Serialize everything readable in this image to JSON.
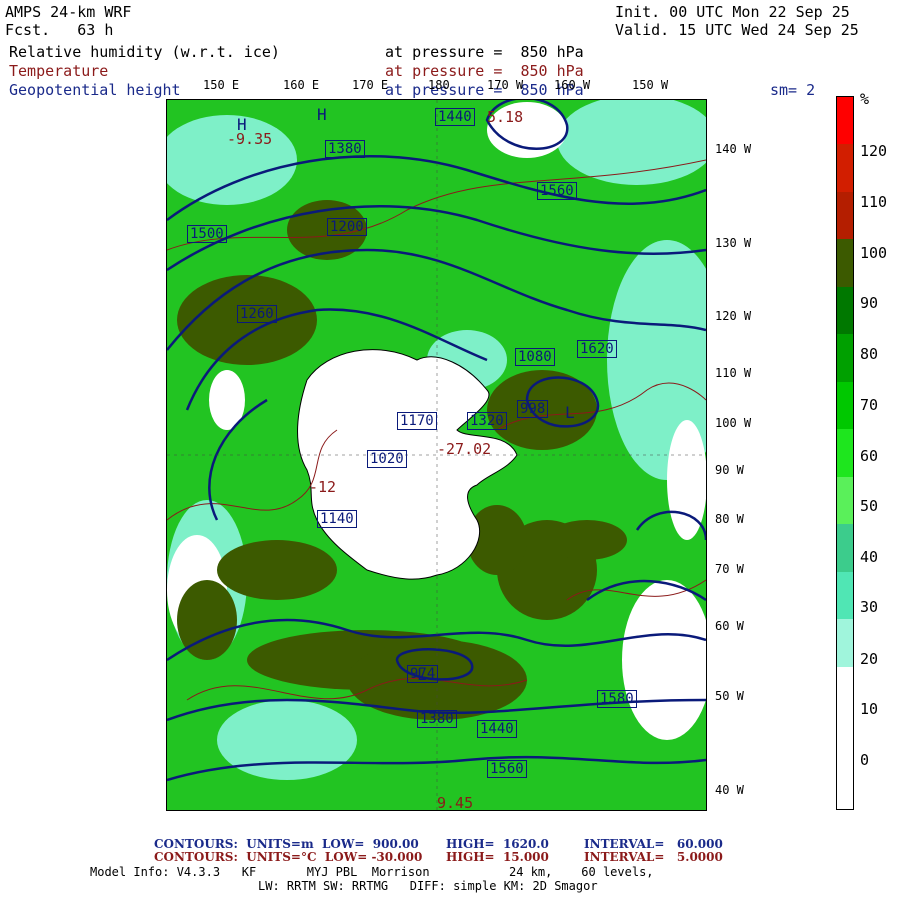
{
  "header": {
    "model_title": "AMPS 24-km WRF",
    "forecast": "Fcst.   63 h",
    "init_time": "Init. 00 UTC Mon 22 Sep 25",
    "valid_time": "Valid. 15 UTC Wed 24 Sep 25",
    "field1_name": "Relative humidity (w.r.t. ice)",
    "field1_level": "at pressure =  850 hPa",
    "field2_name": "Temperature",
    "field2_level": "at pressure =  850 hPa",
    "field3_name": "Geopotential height",
    "field3_level": "at pressure =  850 hPa",
    "smoothing": "sm= 2",
    "colors": {
      "rh_label": "#000000",
      "temp_label": "#8b1a1a",
      "height_label": "#1a2a8a"
    }
  },
  "map": {
    "lon_labels": [
      "150 E",
      "160 E",
      "170 E",
      "180",
      "170 W",
      "160 W",
      "150 W"
    ],
    "lat_labels": [
      "140 W",
      "130 W",
      "120 W",
      "110 W",
      "100 W",
      "90 W",
      "80 W",
      "70 W",
      "60 W",
      "50 W",
      "40 W"
    ],
    "height_contour_labels": [
      "1440",
      "1380",
      "1500",
      "1200",
      "1560",
      "1620",
      "1320",
      "1020",
      "1260",
      "1170",
      "1080",
      "1140",
      "998",
      "974",
      "1380",
      "1440",
      "1560",
      "1580"
    ],
    "temp_labels": [
      "-27.02",
      "-9.35",
      "5.18",
      "-12",
      "9.45"
    ],
    "high_label": "H",
    "low_label": "L",
    "colors": {
      "land": "#ffffff",
      "height_contour": "#0a1a7a",
      "temp_contour": "#8b1a1a",
      "rh_high": "#3a5a1a",
      "rh_mid": "#1ecb1e",
      "rh_low": "#5ee8b8"
    }
  },
  "colorbar": {
    "unit": "%",
    "labels": [
      "120",
      "110",
      "100",
      "90",
      "80",
      "70",
      "60",
      "50",
      "40",
      "30",
      "20",
      "10",
      "0"
    ],
    "segments": [
      "#ff0000",
      "#d21e00",
      "#b41e00",
      "#3c5a00",
      "#007800",
      "#00a000",
      "#00c800",
      "#1ee61e",
      "#5af05a",
      "#3ccc8c",
      "#50e6b4",
      "#a0f5dc",
      "#ffffff",
      "#ffffff",
      "#ffffff"
    ]
  },
  "footer": {
    "contours1_prefix": "CONTOURS:  UNITS=m  LOW=  900.00",
    "contours1_high": "HIGH=  1620.0",
    "contours1_interval": "INTERVAL=   60.000",
    "contours2_prefix": "CONTOURS:  UNITS=°C  LOW= -30.000",
    "contours2_high": "HIGH=  15.000",
    "contours2_interval": "INTERVAL=   5.0000",
    "model_info": "Model Info: V4.3.3   KF       MYJ PBL  Morrison           24 km,    60 levels,",
    "physics_info": "LW: RRTM SW: RRTMG   DIFF: simple KM: 2D Smagor"
  }
}
